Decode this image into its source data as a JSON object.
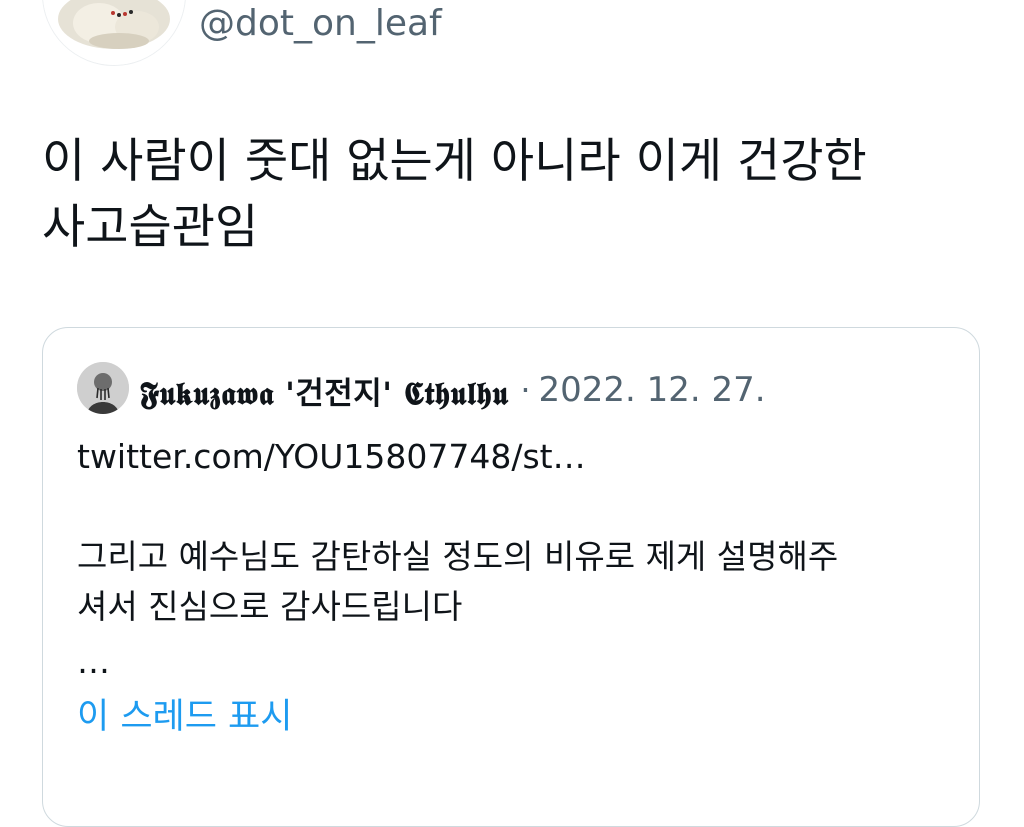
{
  "author": {
    "handle": "@dot_on_leaf"
  },
  "tweet": {
    "text_lines": [
      "이 사람이 줏대 없는게 아니라 이게 건강한",
      "사고습관임"
    ]
  },
  "quoted_tweet": {
    "display_name": "𝕱𝖚𝖐𝖚𝖟𝖆𝖜𝖆 '건전지' 𝕮𝖙𝖍𝖚𝖑𝖍𝖚",
    "separator": "·",
    "date": "2022. 12. 27.",
    "link": "twitter.com/YOU15807748/st…",
    "body_lines": [
      "그리고 예수님도 감탄하실 정도의 비유로 제게 설명해주",
      "셔서 진심으로 감사드립니다"
    ],
    "ellipsis": "…",
    "show_thread_label": "이 스레드 표시"
  },
  "colors": {
    "text_primary": "#0f1419",
    "text_secondary": "#536471",
    "link_blue": "#1d9bf0",
    "card_border": "#cfd9de"
  }
}
